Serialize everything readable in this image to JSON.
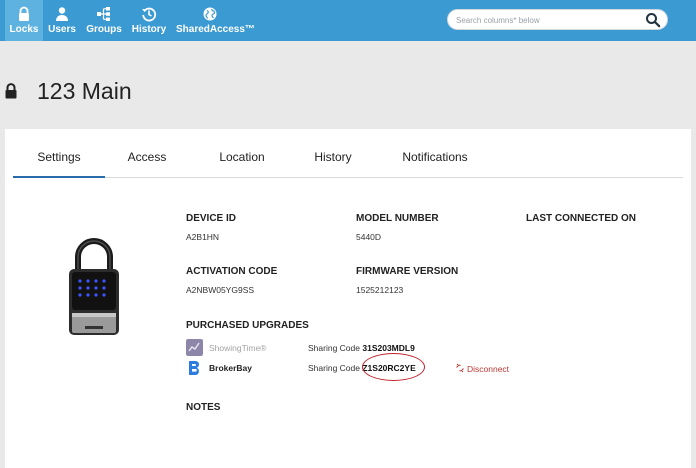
{
  "nav": {
    "items": [
      {
        "label": "Locks",
        "icon": "lock-icon"
      },
      {
        "label": "Users",
        "icon": "user-icon"
      },
      {
        "label": "Groups",
        "icon": "groups-icon"
      },
      {
        "label": "History",
        "icon": "history-icon"
      },
      {
        "label": "SharedAccess™",
        "icon": "globe-icon"
      }
    ],
    "active": "Locks"
  },
  "search": {
    "placeholder": "Search columns* below",
    "value": ""
  },
  "page": {
    "title": "123 Main"
  },
  "tabs": [
    "Settings",
    "Access",
    "Location",
    "History",
    "Notifications"
  ],
  "active_tab": "Settings",
  "device": {
    "device_id_label": "DEVICE ID",
    "device_id": "A2B1HN",
    "model_number_label": "MODEL NUMBER",
    "model_number": "5440D",
    "last_connected_label": "LAST CONNECTED ON",
    "activation_code_label": "ACTIVATION CODE",
    "activation_code": "A2NBW05YG9SS",
    "firmware_label": "FIRMWARE VERSION",
    "firmware": "1525212123"
  },
  "upgrades": {
    "label": "PURCHASED UPGRADES",
    "items": [
      {
        "name": "ShowingTime®",
        "sharing_label": "Sharing Code",
        "code": "31S203MDL9",
        "icon": "showingtime-icon"
      },
      {
        "name": "BrokerBay",
        "sharing_label": "Sharing Code",
        "code": "Z1S20RC2YE",
        "icon": "brokerbay-icon",
        "action": "Disconnect"
      }
    ]
  },
  "notes": {
    "label": "NOTES"
  },
  "colors": {
    "nav_bg": "#3a9ad1",
    "nav_active": "#5eb2e0",
    "tab_underline": "#2a6aa8",
    "disconnect": "#b83a35",
    "annotation_circle": "#c0212b"
  }
}
